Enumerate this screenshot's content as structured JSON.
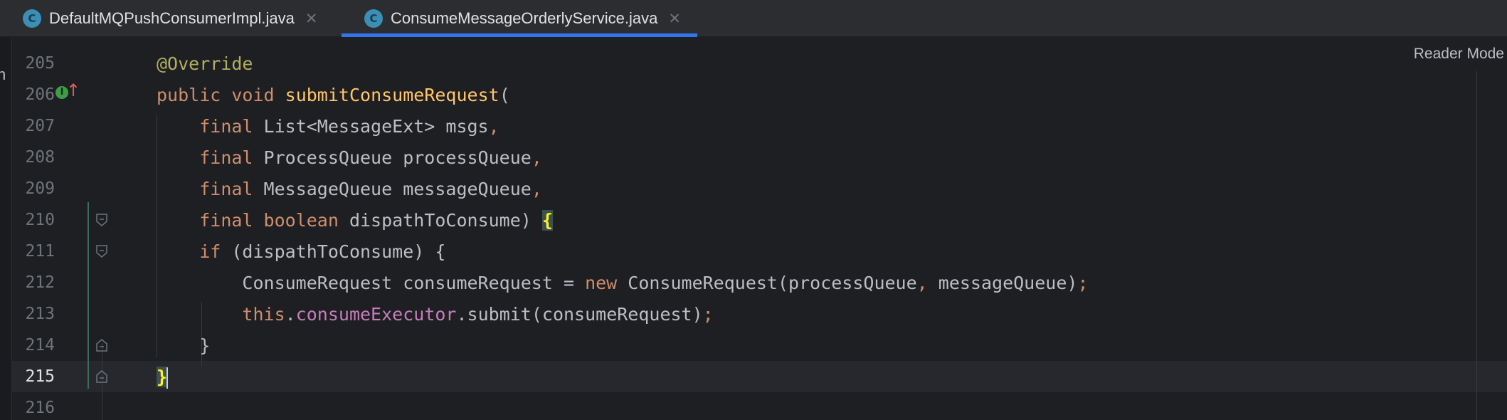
{
  "tabs": [
    {
      "label": "DefaultMQPushConsumerImpl.java",
      "icon": "C",
      "close": "✕",
      "active": false
    },
    {
      "label": "ConsumeMessageOrderlyService.java",
      "icon": "C",
      "close": "✕",
      "active": true
    }
  ],
  "editor": {
    "reader_mode": "Reader Mode",
    "left_edge_char": "n",
    "current_line": "215",
    "gutter_icons": {
      "implements": "I",
      "arrow": "↑"
    },
    "lines": [
      {
        "num": "205",
        "indent": "",
        "tokens": [
          {
            "t": "@Override",
            "c": "ann"
          }
        ]
      },
      {
        "num": "206",
        "indent": "",
        "tokens": [
          {
            "t": "public",
            "c": "kw"
          },
          {
            "t": " ",
            "c": ""
          },
          {
            "t": "void",
            "c": "kw"
          },
          {
            "t": " ",
            "c": ""
          },
          {
            "t": "submitConsumeRequest",
            "c": "fn"
          },
          {
            "t": "(",
            "c": ""
          }
        ]
      },
      {
        "num": "207",
        "indent": "    ",
        "tokens": [
          {
            "t": "final",
            "c": "kw"
          },
          {
            "t": " List<MessageExt> msgs",
            "c": ""
          },
          {
            "t": ",",
            "c": "punc"
          }
        ]
      },
      {
        "num": "208",
        "indent": "    ",
        "tokens": [
          {
            "t": "final",
            "c": "kw"
          },
          {
            "t": " ProcessQueue processQueue",
            "c": ""
          },
          {
            "t": ",",
            "c": "punc"
          }
        ]
      },
      {
        "num": "209",
        "indent": "    ",
        "tokens": [
          {
            "t": "final",
            "c": "kw"
          },
          {
            "t": " MessageQueue messageQueue",
            "c": ""
          },
          {
            "t": ",",
            "c": "punc"
          }
        ]
      },
      {
        "num": "210",
        "indent": "    ",
        "tokens": [
          {
            "t": "final",
            "c": "kw"
          },
          {
            "t": " ",
            "c": ""
          },
          {
            "t": "boolean",
            "c": "kw"
          },
          {
            "t": " dispathToConsume) ",
            "c": ""
          },
          {
            "t": "{",
            "c": "brace-match"
          }
        ]
      },
      {
        "num": "211",
        "indent": "    ",
        "tokens": [
          {
            "t": "if",
            "c": "kw"
          },
          {
            "t": " (dispathToConsume) {",
            "c": ""
          }
        ]
      },
      {
        "num": "212",
        "indent": "        ",
        "tokens": [
          {
            "t": "ConsumeRequest consumeRequest = ",
            "c": ""
          },
          {
            "t": "new",
            "c": "kw"
          },
          {
            "t": " ConsumeRequest(processQueue",
            "c": ""
          },
          {
            "t": ",",
            "c": "punc"
          },
          {
            "t": " messageQueue)",
            "c": ""
          },
          {
            "t": ";",
            "c": "punc"
          }
        ]
      },
      {
        "num": "213",
        "indent": "        ",
        "tokens": [
          {
            "t": "this",
            "c": "kw"
          },
          {
            "t": ".",
            "c": ""
          },
          {
            "t": "consumeExecutor",
            "c": "fld"
          },
          {
            "t": ".submit(consumeRequest)",
            "c": ""
          },
          {
            "t": ";",
            "c": "punc"
          }
        ]
      },
      {
        "num": "214",
        "indent": "    ",
        "tokens": [
          {
            "t": "}",
            "c": ""
          }
        ]
      },
      {
        "num": "215",
        "indent": "",
        "tokens": [
          {
            "t": "}",
            "c": "brace-match"
          }
        ],
        "caret": true
      },
      {
        "num": "216",
        "indent": "",
        "tokens": []
      }
    ]
  },
  "colors": {
    "background": "#1E1F22",
    "tab_bar": "#2B2D30",
    "active_tab_underline": "#3574F0",
    "keyword": "#CF8E6D",
    "annotation": "#B3AE60",
    "method_declaration": "#FFC66D",
    "field": "#C77DBB",
    "text": "#BCBEC4",
    "matched_brace": "#FFEF28"
  }
}
